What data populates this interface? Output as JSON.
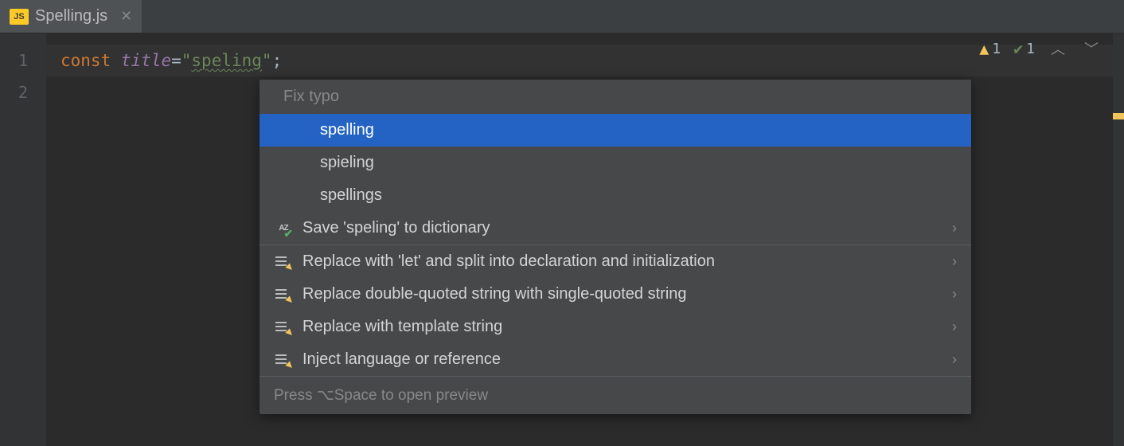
{
  "tab": {
    "icon_text": "JS",
    "name": "Spelling.js"
  },
  "gutter": {
    "lines": [
      "1",
      "2"
    ]
  },
  "code": {
    "keyword": "const",
    "varname": "title",
    "equals": " = ",
    "q1": "\"",
    "string_content": "speling",
    "q2": "\"",
    "semicolon": ";"
  },
  "inspector": {
    "warn_count": "1",
    "ok_count": "1"
  },
  "popup": {
    "header": "Fix typo",
    "suggestions": [
      {
        "label": "spelling",
        "selected": true
      },
      {
        "label": "spieling",
        "selected": false
      },
      {
        "label": "spellings",
        "selected": false
      }
    ],
    "dict_action": "Save 'speling' to dictionary",
    "intentions": [
      "Replace with 'let' and split into declaration and initialization",
      "Replace double-quoted string with single-quoted string",
      "Replace with template string",
      "Inject language or reference"
    ],
    "footer": "Press ⌥Space to open preview"
  }
}
